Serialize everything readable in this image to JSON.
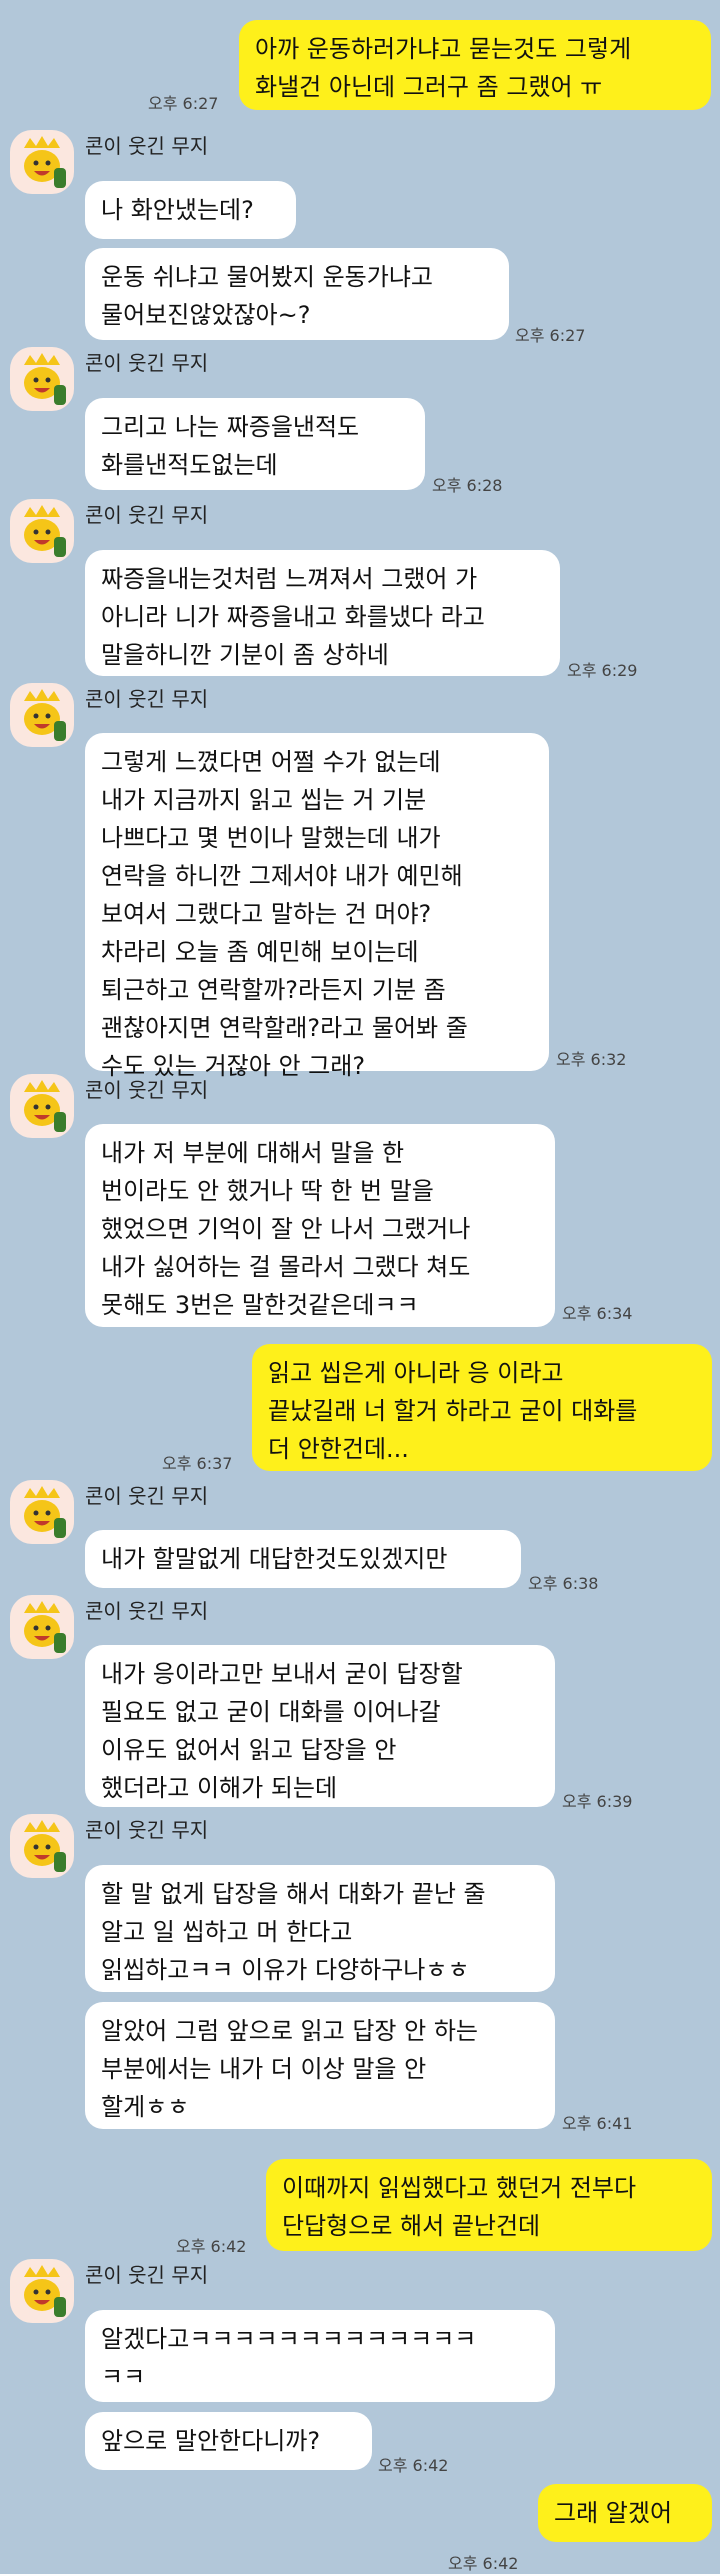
{
  "friend_name": "콘이 웃긴 무지",
  "colors": {
    "background": "#b2c7d9",
    "incoming": "#ffffff",
    "outgoing": "#fef01b"
  },
  "messages": [
    {
      "dir": "out",
      "text": "아까 운동하러가냐고 묻는것도 그렇게\n화낼건 아닌데 그러구 좀 그랬어 ㅠ",
      "time": "오후 6:27"
    },
    {
      "dir": "in",
      "text": "나 화안냈는데?"
    },
    {
      "dir": "in",
      "text": "운동 쉬냐고 물어봤지 운동가냐고\n물어보진않았잖아~?",
      "time": "오후 6:27"
    },
    {
      "dir": "in",
      "text": "그리고 나는 짜증을낸적도\n화를낸적도없는데",
      "time": "오후 6:28"
    },
    {
      "dir": "in",
      "text": "짜증을내는것처럼 느껴져서 그랬어 가\n아니라 니가 짜증을내고 화를냈다 라고\n말을하니깐 기분이 좀 상하네",
      "time": "오후 6:29"
    },
    {
      "dir": "in",
      "text": "그렇게 느꼈다면 어쩔 수가 없는데\n내가 지금까지 읽고 씹는 거 기분\n나쁘다고 몇 번이나 말했는데 내가\n연락을 하니깐 그제서야 내가 예민해\n보여서 그랬다고 말하는 건 머야?\n차라리 오늘 좀 예민해 보이는데\n퇴근하고 연락할까?라든지 기분 좀\n괜찮아지면 연락할래?라고 물어봐 줄\n수도 있는 거잖아 안 그래?",
      "time": "오후 6:32"
    },
    {
      "dir": "in",
      "text": "내가 저 부분에 대해서 말을 한\n번이라도 안 했거나 딱 한 번 말을\n했었으면 기억이 잘 안 나서 그랬거나\n내가 싫어하는 걸 몰라서 그랬다 쳐도\n못해도 3번은 말한것같은데ㅋㅋ",
      "time": "오후 6:34"
    },
    {
      "dir": "out",
      "text": "읽고 씹은게 아니라 응 이라고\n끝났길래 너 할거 하라고 굳이 대화를\n더 안한건데...",
      "time": "오후 6:37"
    },
    {
      "dir": "in",
      "text": "내가 할말없게 대답한것도있겠지만",
      "time": "오후 6:38"
    },
    {
      "dir": "in",
      "text": "내가 응이라고만 보내서 굳이 답장할\n필요도 없고 굳이 대화를 이어나갈\n이유도 없어서 읽고 답장을 안\n했더라고 이해가 되는데",
      "time": "오후 6:39"
    },
    {
      "dir": "in",
      "text": "할 말 없게 답장을 해서 대화가 끝난 줄\n알고 일 씹하고 머 한다고\n읽씹하고ㅋㅋ 이유가 다양하구나ㅎㅎ"
    },
    {
      "dir": "in",
      "text": "알았어 그럼 앞으로 읽고 답장 안 하는\n부분에서는 내가 더 이상 말을 안\n할게ㅎㅎ",
      "time": "오후 6:41"
    },
    {
      "dir": "out",
      "text": "이때까지 읽씹했다고 했던거 전부다\n단답형으로 해서 끝난건데",
      "time": "오후 6:42"
    },
    {
      "dir": "in",
      "text": "알겠다고ㅋㅋㅋㅋㅋㅋㅋㅋㅋㅋㅋㅋㅋ\nㅋㅋ"
    },
    {
      "dir": "in",
      "text": "앞으로 말안한다니까?",
      "time": "오후 6:42"
    },
    {
      "dir": "out",
      "text": "그래 알겠어",
      "time": "오후 6:42"
    }
  ]
}
